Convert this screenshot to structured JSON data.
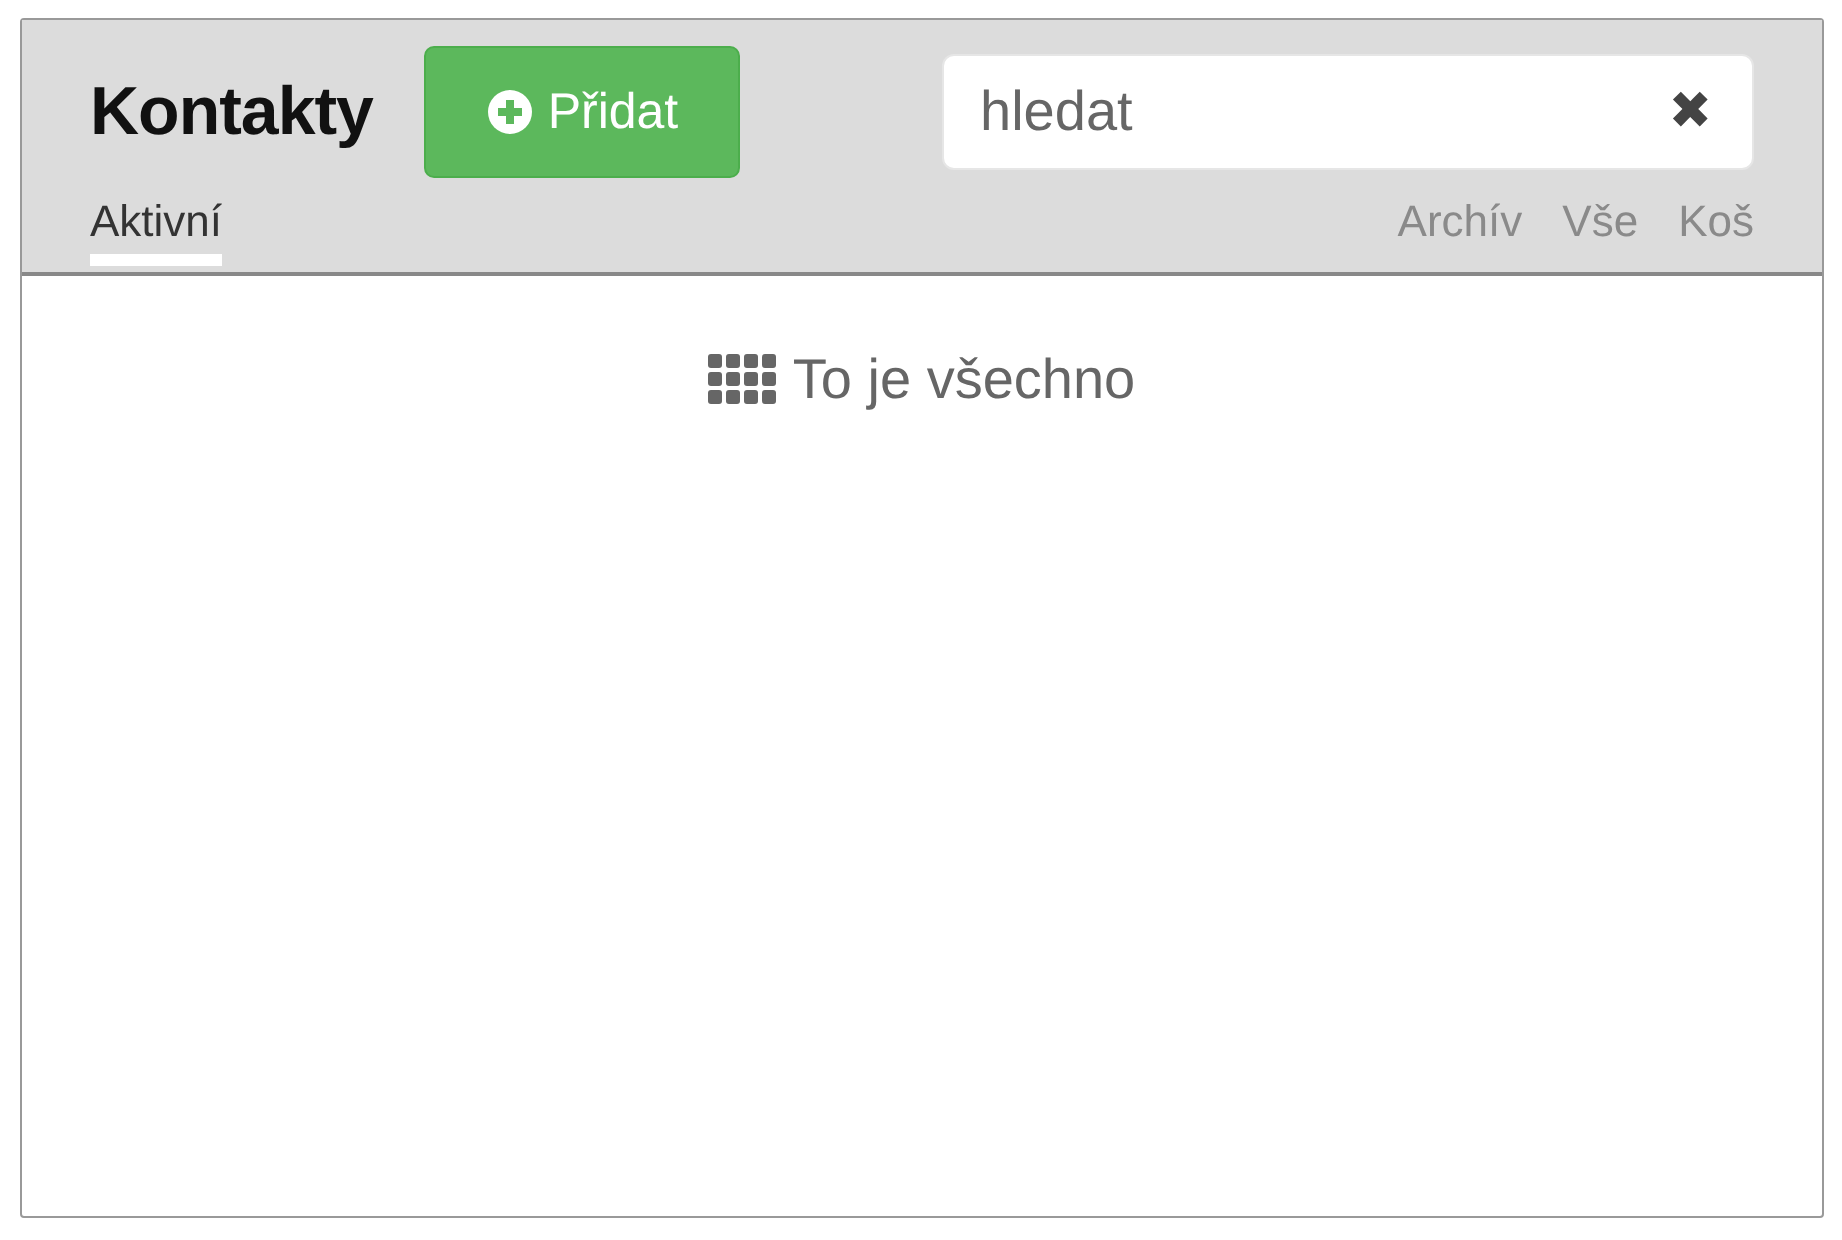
{
  "title": "Kontakty",
  "add_button": {
    "label": "Přidat"
  },
  "search": {
    "placeholder": "hledat",
    "clear": "✖"
  },
  "tabs_left": [
    {
      "label": "Aktivní",
      "selected": true
    }
  ],
  "tabs_right": [
    {
      "label": "Archív",
      "selected": false
    },
    {
      "label": "Vše",
      "selected": false
    },
    {
      "label": "Koš",
      "selected": false
    }
  ],
  "empty_message": "To je všechno"
}
